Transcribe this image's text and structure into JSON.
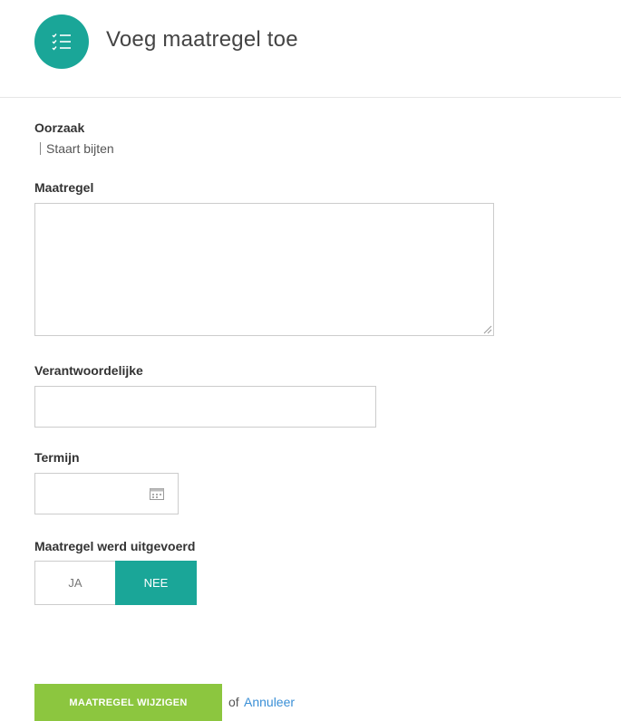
{
  "colors": {
    "accent": "#1aa698",
    "submit": "#8cc63f",
    "link": "#3a8fd6"
  },
  "icons": {
    "header": "checklist-icon",
    "date": "calendar-icon",
    "textarea": "resize-grip-icon"
  },
  "header": {
    "title": "Voeg maatregel toe"
  },
  "form": {
    "cause": {
      "label": "Oorzaak",
      "value": "Staart bijten"
    },
    "measure": {
      "label": "Maatregel",
      "value": ""
    },
    "responsible": {
      "label": "Verantwoordelijke",
      "value": ""
    },
    "deadline": {
      "label": "Termijn",
      "value": ""
    },
    "executed": {
      "label": "Maatregel werd uitgevoerd",
      "options": [
        "JA",
        "NEE"
      ],
      "selected": "NEE"
    }
  },
  "actions": {
    "submit_label": "MAATREGEL WIJZIGEN",
    "or_text": "of",
    "cancel_label": "Annuleer"
  }
}
